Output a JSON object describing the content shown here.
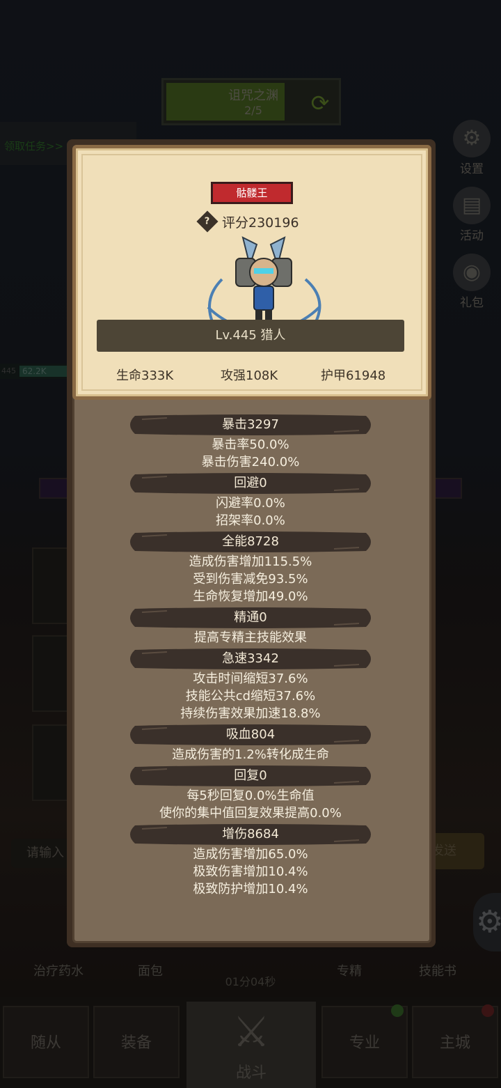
{
  "background": {
    "dungeon": {
      "title": "诅咒之渊",
      "progress": "2/5"
    },
    "quest_link": "领取任务>>",
    "side_buttons": [
      {
        "label": "设置",
        "icon": "gear-icon"
      },
      {
        "label": "活动",
        "icon": "scroll-icon"
      },
      {
        "label": "礼包",
        "icon": "gift-icon"
      }
    ],
    "companion_hp": {
      "level": "445",
      "value": "62.2K"
    },
    "chat_placeholder": "请输入",
    "send_label": "发送",
    "skills": [
      {
        "label": "治疗药水"
      },
      {
        "label": "面包"
      },
      {
        "label": "专精"
      },
      {
        "label": "技能书"
      }
    ],
    "timer": "01分04秒",
    "nav": {
      "tab_companions": "随从",
      "tab_equipment": "装备",
      "tab_battle": "战斗",
      "tab_profession": "专业",
      "tab_main_city": "主城"
    }
  },
  "hero": {
    "name": "骷髅王",
    "score": "评分230196",
    "level_class": "Lv.445 猎人",
    "hp": "生命333K",
    "attack": "攻强108K",
    "armor": "护甲61948"
  },
  "stats": [
    {
      "title": "暴击3297",
      "lines": [
        "暴击率50.0%",
        "暴击伤害240.0%"
      ]
    },
    {
      "title": "回避0",
      "lines": [
        "闪避率0.0%",
        "招架率0.0%"
      ]
    },
    {
      "title": "全能8728",
      "lines": [
        "造成伤害增加115.5%",
        "受到伤害减免93.5%",
        "生命恢复增加49.0%"
      ]
    },
    {
      "title": "精通0",
      "lines": [
        "提高专精主技能效果"
      ]
    },
    {
      "title": "急速3342",
      "lines": [
        "攻击时间缩短37.6%",
        "技能公共cd缩短37.6%",
        "持续伤害效果加速18.8%"
      ]
    },
    {
      "title": "吸血804",
      "lines": [
        "造成伤害的1.2%转化成生命"
      ]
    },
    {
      "title": "回复0",
      "lines": [
        "每5秒回复0.0%生命值",
        "使你的集中值回复效果提高0.0%"
      ]
    },
    {
      "title": "增伤8684",
      "lines": [
        "造成伤害增加65.0%",
        "极致伤害增加10.4%",
        "极致防护增加10.4%"
      ]
    }
  ],
  "colors": {
    "name_badge": "#c02a2e",
    "card_bg": "#f0dfb9",
    "panel_bg": "#7b6a57",
    "stat_header": "#3a302a"
  }
}
